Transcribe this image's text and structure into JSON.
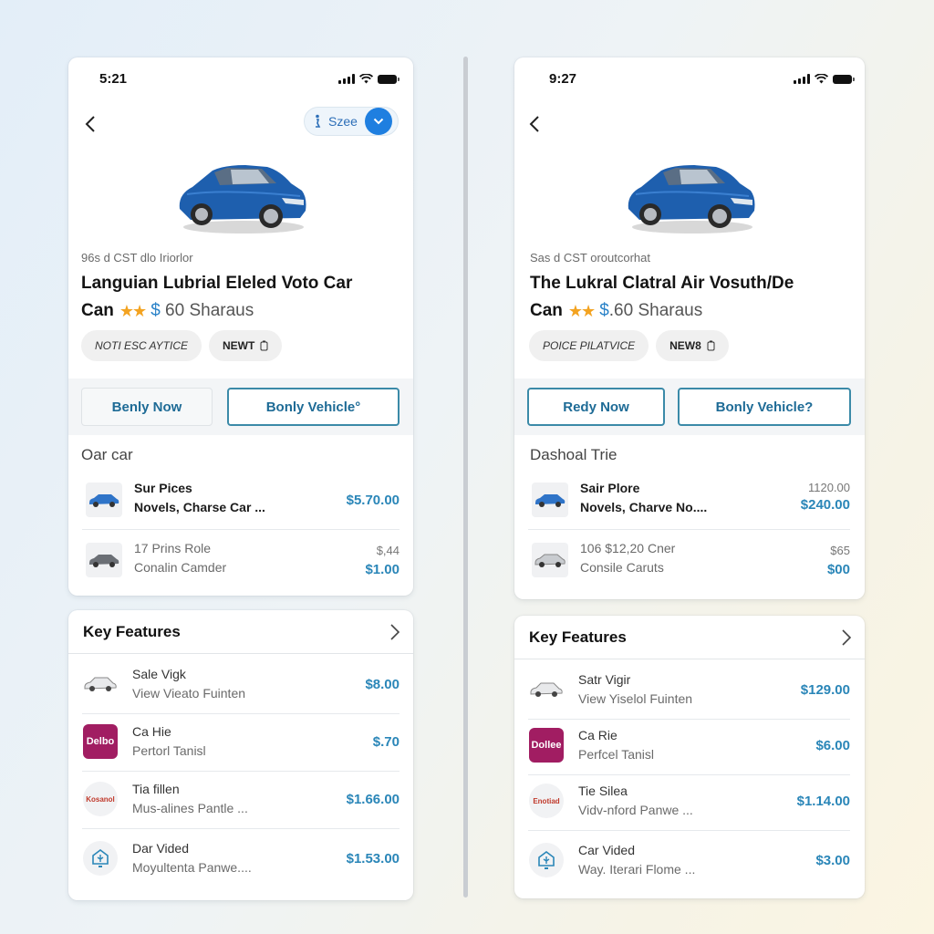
{
  "screens": [
    {
      "status_time": "5:21",
      "size_selector": {
        "label": "Szee"
      },
      "subtitle": "96s d CST dlo Iriorlor",
      "title": "Languian Lubrial Eleled Voto Car",
      "rating_line": {
        "prefix": "Can",
        "stars": "★★",
        "dollar": "$",
        "price_text": " 60 Sharaus",
        "rating": 2
      },
      "chips": [
        {
          "label": "NOTI ESC AYTICE"
        },
        {
          "label": "NEWT"
        }
      ],
      "buttons": {
        "primary": "Benly Now",
        "secondary": "Bonly Vehicle°"
      },
      "section_title": "Oar car",
      "list": [
        {
          "line1": "Sur Pices",
          "line2": "Novels, Charse Car ...",
          "price": "$5.70.00",
          "old_price": ""
        },
        {
          "line1": "17 Prins Role",
          "line2": "Conalin Camder",
          "price": "$1.00",
          "old_price": "$,44"
        }
      ],
      "key_features": {
        "title": "Key Features",
        "items": [
          {
            "icon": "car-icon",
            "line1": "Sale Vigk",
            "line2": "View Vieato Fuinten",
            "price": "$8.00"
          },
          {
            "icon": "brand-logo-icon",
            "brand_text": "Delbo",
            "line1": "Ca Hie",
            "line2": "Pertorl Tanisl",
            "price": "$.70"
          },
          {
            "icon": "brand-badge-icon",
            "brand_text": "Kosanol",
            "line1": "Tia fillen",
            "line2": "Mus-alines Pantle ...",
            "price": "$1.66.00"
          },
          {
            "icon": "shield-device-icon",
            "line1": "Dar Vided",
            "line2": "Moyultenta Panwe....",
            "price": "$1.53.00"
          }
        ]
      }
    },
    {
      "status_time": "9:27",
      "subtitle": "Sas d CST oroutcorhat",
      "title": "The Lukral Clatral Air Vosuth/De",
      "rating_line": {
        "prefix": "Can",
        "stars": "★★",
        "dollar": "$",
        "price_text": ".60 Sharaus",
        "rating": 2
      },
      "chips": [
        {
          "label": "POICE PILATVICE"
        },
        {
          "label": "NEW8"
        }
      ],
      "buttons": {
        "primary": "Redy Now",
        "secondary": "Bonly Vehicle?"
      },
      "section_title": "Dashoal Trie",
      "list": [
        {
          "line1": "Sair Plore",
          "line2": "Novels, Charve No....",
          "price": "$240.00",
          "old_price": "1120.00"
        },
        {
          "line1": "106 $12,20 Cner",
          "line2": "Consile Caruts",
          "price": "$00",
          "old_price": "$65"
        }
      ],
      "key_features": {
        "title": "Key Features",
        "items": [
          {
            "icon": "car-icon",
            "line1": "Satr Vigir",
            "line2": "View Yiselol Fuinten",
            "price": "$129.00"
          },
          {
            "icon": "brand-logo-icon",
            "brand_text": "Dollee",
            "line1": "Ca Rie",
            "line2": "Perfcel Tanisl",
            "price": "$6.00"
          },
          {
            "icon": "brand-badge-icon",
            "brand_text": "Enotiad",
            "line1": "Tie Silea",
            "line2": "Vidv-nford Panwe ...",
            "price": "$1.14.00"
          },
          {
            "icon": "shield-device-icon",
            "line1": "Car Vided",
            "line2": "Way. Iterari Flome ...",
            "price": "$3.00"
          }
        ]
      }
    }
  ],
  "colors": {
    "accent_blue": "#1f7fe0",
    "price_blue": "#2a86b8",
    "button_text": "#1e6b96",
    "star": "#f3a321",
    "brand_magenta": "#a11d62"
  }
}
